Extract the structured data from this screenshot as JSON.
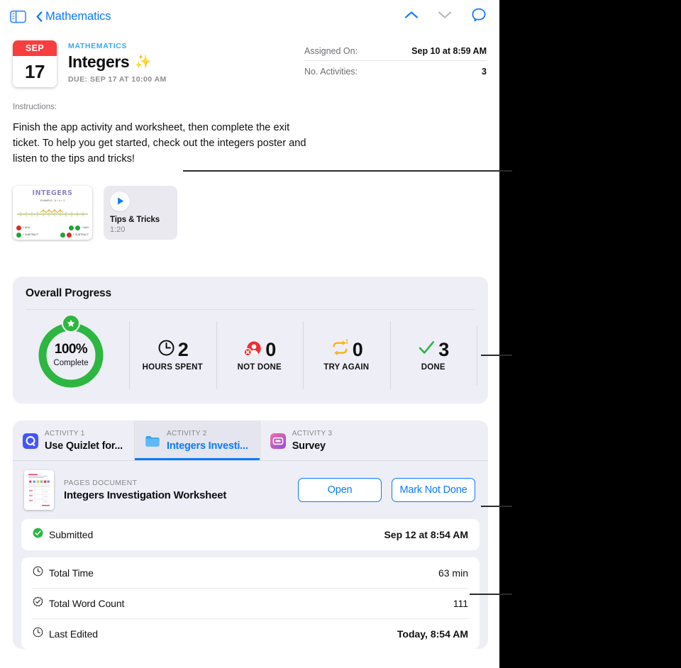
{
  "navbar": {
    "sidebar_toggle_icon": "sidebar-toggle-icon",
    "back_label": "Mathematics",
    "up_icon": "chevron-up-icon",
    "down_icon": "chevron-down-icon",
    "comment_icon": "comment-bubble-icon",
    "accent": "#0a7aff",
    "disabled": "#b9b9be"
  },
  "assignment": {
    "calendar": {
      "month": "SEP",
      "day": "17",
      "month_bg": "#f93e3e"
    },
    "subject": "MATHEMATICS",
    "title": "Integers",
    "title_emoji": "✨",
    "due": "DUE: SEP 17 AT 10:00 AM",
    "meta": [
      {
        "label": "Assigned On:",
        "value": "Sep 10 at 8:59 AM"
      },
      {
        "label": "No. Activities:",
        "value": "3"
      }
    ]
  },
  "instructions": {
    "label": "Instructions:",
    "body": "Finish the app activity and worksheet, then complete the exit ticket. To help you get started, check out the integers poster and listen to the tips and tricks!"
  },
  "attachments": {
    "poster": {
      "name": "integers-poster-thumbnail",
      "title": "INTEGERS",
      "subtitle": "EXAMPLE: -5 + 4 = 1",
      "legend": [
        {
          "left_sign": "−",
          "left_color": "#de2a2a",
          "text": "+ ADD"
        },
        {
          "left_sign": "+",
          "left_color": "#1ea438",
          "text": "+ SUBTRACT"
        }
      ]
    },
    "video": {
      "title": "Tips & Tricks",
      "duration": "1:20",
      "play_icon": "play-icon"
    }
  },
  "progress": {
    "title": "Overall Progress",
    "ring": {
      "percent_label": "100%",
      "complete_label": "Complete",
      "percent_value": 100,
      "color": "#2bb740",
      "star_icon": "star-badge-icon"
    },
    "stats": [
      {
        "icon": "clock-icon",
        "value": "2",
        "label": "HOURS SPENT",
        "icon_color": "#111111"
      },
      {
        "icon": "not-done-icon",
        "value": "0",
        "label": "NOT DONE",
        "icon_color": "#f32c2c"
      },
      {
        "icon": "try-again-icon",
        "value": "0",
        "label": "TRY AGAIN",
        "icon_color": "#fcb317"
      },
      {
        "icon": "checkmark-icon",
        "value": "3",
        "label": "DONE",
        "icon_color": "#2bb740"
      }
    ]
  },
  "activities": {
    "tabs": [
      {
        "kicker": "ACTIVITY 1",
        "name": "Use Quizlet for...",
        "icon": "quizlet-app-icon",
        "active": false
      },
      {
        "kicker": "ACTIVITY 2",
        "name": "Integers Investi...",
        "icon": "pages-document-icon",
        "active": true
      },
      {
        "kicker": "ACTIVITY 3",
        "name": "Survey",
        "icon": "survey-app-icon",
        "active": false
      }
    ],
    "document": {
      "kicker": "PAGES DOCUMENT",
      "name": "Integers Investigation Worksheet",
      "thumbnail_icon": "pages-worksheet-thumbnail",
      "open_label": "Open",
      "mark_not_done_label": "Mark Not Done"
    },
    "submitted": {
      "icon": "checkmark-circle-icon",
      "label": "Submitted",
      "value": "Sep 12 at 8:54 AM"
    },
    "details": [
      {
        "icon": "clock-icon",
        "label": "Total Time",
        "value": "63 min",
        "bold": false
      },
      {
        "icon": "word-count-icon",
        "label": "Total Word Count",
        "value": "111",
        "bold": false
      },
      {
        "icon": "clock-icon",
        "label": "Last Edited",
        "value": "Today, 8:54 AM",
        "bold": true
      }
    ]
  }
}
